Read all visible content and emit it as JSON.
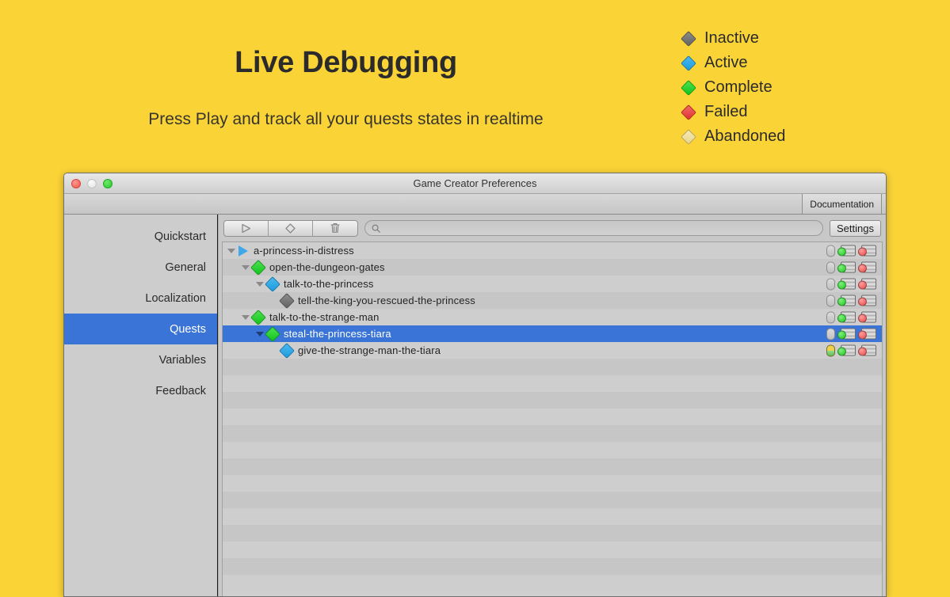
{
  "promo": {
    "title": "Live Debugging",
    "subtitle": "Press Play and track all your quests states in realtime"
  },
  "legend": {
    "items": [
      {
        "label": "Inactive",
        "state": "inactive",
        "color": "#6d6d6d"
      },
      {
        "label": "Active",
        "state": "active",
        "color": "#22a0e2"
      },
      {
        "label": "Complete",
        "state": "complete",
        "color": "#16c81e"
      },
      {
        "label": "Failed",
        "state": "failed",
        "color": "#e03232"
      },
      {
        "label": "Abandoned",
        "state": "abandoned",
        "color": "#e8d68d"
      }
    ]
  },
  "window": {
    "title": "Game Creator Preferences",
    "traffic_lights": [
      "close",
      "minimize",
      "zoom"
    ],
    "documentation_label": "Documentation"
  },
  "sidebar": {
    "items": [
      {
        "label": "Quickstart",
        "selected": false
      },
      {
        "label": "General",
        "selected": false
      },
      {
        "label": "Localization",
        "selected": false
      },
      {
        "label": "Quests",
        "selected": true
      },
      {
        "label": "Variables",
        "selected": false
      },
      {
        "label": "Feedback",
        "selected": false
      }
    ]
  },
  "toolbar": {
    "buttons": [
      {
        "icon": "play-icon"
      },
      {
        "icon": "diamond-icon"
      },
      {
        "icon": "trash-icon"
      }
    ],
    "search": {
      "value": "",
      "placeholder": ""
    },
    "settings_label": "Settings"
  },
  "tree": {
    "rows": [
      {
        "label": "a-princess-in-distress",
        "depth": 0,
        "icon": "play-icon",
        "state": "active",
        "expanded": true,
        "selected": false,
        "actions": {
          "pill": false,
          "green": false,
          "red": false
        }
      },
      {
        "label": "open-the-dungeon-gates",
        "depth": 1,
        "icon": "diamond-icon",
        "state": "complete",
        "expanded": true,
        "selected": false,
        "actions": {
          "pill": false,
          "green": false,
          "red": false
        }
      },
      {
        "label": "talk-to-the-princess",
        "depth": 2,
        "icon": "diamond-icon",
        "state": "active",
        "expanded": true,
        "selected": false,
        "actions": {
          "pill": false,
          "green": false,
          "red": false
        }
      },
      {
        "label": "tell-the-king-you-rescued-the-princess",
        "depth": 3,
        "icon": "diamond-icon",
        "state": "inactive",
        "expanded": false,
        "selected": false,
        "actions": {
          "pill": false,
          "green": true,
          "red": false
        }
      },
      {
        "label": "talk-to-the-strange-man",
        "depth": 1,
        "icon": "diamond-icon",
        "state": "complete",
        "expanded": true,
        "selected": false,
        "actions": {
          "pill": false,
          "green": false,
          "red": false
        }
      },
      {
        "label": "steal-the-princess-tiara",
        "depth": 2,
        "icon": "diamond-icon",
        "state": "complete",
        "expanded": true,
        "selected": true,
        "actions": {
          "pill": false,
          "green": false,
          "red": false
        }
      },
      {
        "label": "give-the-strange-man-the-tiara",
        "depth": 3,
        "icon": "diamond-icon",
        "state": "active",
        "expanded": false,
        "selected": false,
        "actions": {
          "pill": true,
          "green": true,
          "red": false
        }
      }
    ],
    "empty_rows": 14
  }
}
